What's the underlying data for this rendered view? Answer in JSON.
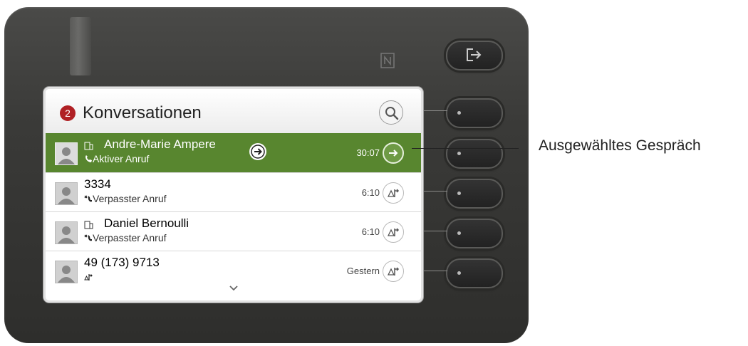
{
  "header": {
    "badge_count": "2",
    "title": "Konversationen",
    "search_icon": "search-icon"
  },
  "conversations": [
    {
      "name": "Andre-Marie Ampere",
      "status": "Aktiver Anruf",
      "status_icon": "phone-active-icon",
      "time": "30:07",
      "action_icon": "arrow-right-icon",
      "selected": true,
      "has_building_icon": true
    },
    {
      "name": "3334",
      "status": "Verpasster Anruf",
      "status_icon": "missed-call-icon",
      "time": "6:10",
      "action_icon": "callback-icon",
      "selected": false,
      "has_building_icon": false
    },
    {
      "name": "Daniel Bernoulli",
      "status": "Verpasster Anruf",
      "status_icon": "missed-call-icon",
      "time": "6:10",
      "action_icon": "callback-icon",
      "selected": false,
      "has_building_icon": true
    },
    {
      "name": "49 (173) 9713",
      "status": "",
      "status_icon": "outgoing-call-icon",
      "time": "Gestern",
      "action_icon": "callback-icon",
      "selected": false,
      "has_building_icon": false
    }
  ],
  "annotation": "Ausgewähltes Gespräch",
  "colors": {
    "selected_row": "#58862f",
    "badge": "#b02024",
    "housing": "#3a3a38"
  }
}
